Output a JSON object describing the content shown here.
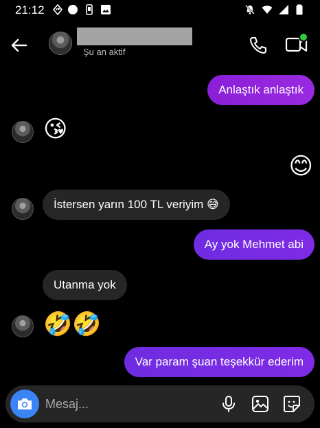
{
  "status_bar": {
    "time": "21:12",
    "left_icons": [
      "navigation-icon",
      "circle-icon",
      "phone-icon",
      "image-icon"
    ],
    "right_icons": [
      "mute-icon",
      "wifi-icon",
      "signal-icon",
      "battery-icon"
    ]
  },
  "header": {
    "contact_name_redacted": true,
    "status": "Şu an aktif",
    "online": true
  },
  "messages": [
    {
      "from": "me",
      "text": "Anlaştık anlaştık"
    },
    {
      "from": "them",
      "text": "😘",
      "emoji": true
    },
    {
      "from": "me",
      "text": "😊",
      "emoji": true
    },
    {
      "from": "them",
      "text": "İstersen yarın 100 TL veriyim 😅"
    },
    {
      "from": "me",
      "text": "Ay yok Mehmet abi"
    },
    {
      "from": "them",
      "text": "Utanma yok"
    },
    {
      "from": "them",
      "text": "🤣🤣",
      "emoji": true
    },
    {
      "from": "me",
      "text": "Var param şuan teşekkür ederim"
    }
  ],
  "composer": {
    "placeholder": "Mesaj...",
    "camera_color": "#3a84f5"
  },
  "colors": {
    "outgoing_bubble": "#7a2be4",
    "incoming_bubble": "#262626",
    "online_dot": "#2ecc40"
  }
}
